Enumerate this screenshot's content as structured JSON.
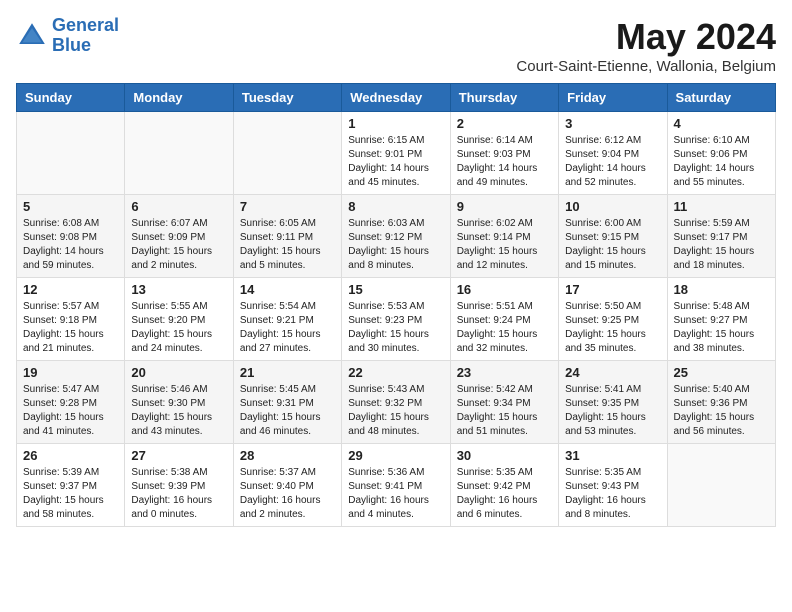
{
  "header": {
    "logo_line1": "General",
    "logo_line2": "Blue",
    "month": "May 2024",
    "location": "Court-Saint-Etienne, Wallonia, Belgium"
  },
  "weekdays": [
    "Sunday",
    "Monday",
    "Tuesday",
    "Wednesday",
    "Thursday",
    "Friday",
    "Saturday"
  ],
  "weeks": [
    [
      {
        "day": "",
        "info": ""
      },
      {
        "day": "",
        "info": ""
      },
      {
        "day": "",
        "info": ""
      },
      {
        "day": "1",
        "info": "Sunrise: 6:15 AM\nSunset: 9:01 PM\nDaylight: 14 hours\nand 45 minutes."
      },
      {
        "day": "2",
        "info": "Sunrise: 6:14 AM\nSunset: 9:03 PM\nDaylight: 14 hours\nand 49 minutes."
      },
      {
        "day": "3",
        "info": "Sunrise: 6:12 AM\nSunset: 9:04 PM\nDaylight: 14 hours\nand 52 minutes."
      },
      {
        "day": "4",
        "info": "Sunrise: 6:10 AM\nSunset: 9:06 PM\nDaylight: 14 hours\nand 55 minutes."
      }
    ],
    [
      {
        "day": "5",
        "info": "Sunrise: 6:08 AM\nSunset: 9:08 PM\nDaylight: 14 hours\nand 59 minutes."
      },
      {
        "day": "6",
        "info": "Sunrise: 6:07 AM\nSunset: 9:09 PM\nDaylight: 15 hours\nand 2 minutes."
      },
      {
        "day": "7",
        "info": "Sunrise: 6:05 AM\nSunset: 9:11 PM\nDaylight: 15 hours\nand 5 minutes."
      },
      {
        "day": "8",
        "info": "Sunrise: 6:03 AM\nSunset: 9:12 PM\nDaylight: 15 hours\nand 8 minutes."
      },
      {
        "day": "9",
        "info": "Sunrise: 6:02 AM\nSunset: 9:14 PM\nDaylight: 15 hours\nand 12 minutes."
      },
      {
        "day": "10",
        "info": "Sunrise: 6:00 AM\nSunset: 9:15 PM\nDaylight: 15 hours\nand 15 minutes."
      },
      {
        "day": "11",
        "info": "Sunrise: 5:59 AM\nSunset: 9:17 PM\nDaylight: 15 hours\nand 18 minutes."
      }
    ],
    [
      {
        "day": "12",
        "info": "Sunrise: 5:57 AM\nSunset: 9:18 PM\nDaylight: 15 hours\nand 21 minutes."
      },
      {
        "day": "13",
        "info": "Sunrise: 5:55 AM\nSunset: 9:20 PM\nDaylight: 15 hours\nand 24 minutes."
      },
      {
        "day": "14",
        "info": "Sunrise: 5:54 AM\nSunset: 9:21 PM\nDaylight: 15 hours\nand 27 minutes."
      },
      {
        "day": "15",
        "info": "Sunrise: 5:53 AM\nSunset: 9:23 PM\nDaylight: 15 hours\nand 30 minutes."
      },
      {
        "day": "16",
        "info": "Sunrise: 5:51 AM\nSunset: 9:24 PM\nDaylight: 15 hours\nand 32 minutes."
      },
      {
        "day": "17",
        "info": "Sunrise: 5:50 AM\nSunset: 9:25 PM\nDaylight: 15 hours\nand 35 minutes."
      },
      {
        "day": "18",
        "info": "Sunrise: 5:48 AM\nSunset: 9:27 PM\nDaylight: 15 hours\nand 38 minutes."
      }
    ],
    [
      {
        "day": "19",
        "info": "Sunrise: 5:47 AM\nSunset: 9:28 PM\nDaylight: 15 hours\nand 41 minutes."
      },
      {
        "day": "20",
        "info": "Sunrise: 5:46 AM\nSunset: 9:30 PM\nDaylight: 15 hours\nand 43 minutes."
      },
      {
        "day": "21",
        "info": "Sunrise: 5:45 AM\nSunset: 9:31 PM\nDaylight: 15 hours\nand 46 minutes."
      },
      {
        "day": "22",
        "info": "Sunrise: 5:43 AM\nSunset: 9:32 PM\nDaylight: 15 hours\nand 48 minutes."
      },
      {
        "day": "23",
        "info": "Sunrise: 5:42 AM\nSunset: 9:34 PM\nDaylight: 15 hours\nand 51 minutes."
      },
      {
        "day": "24",
        "info": "Sunrise: 5:41 AM\nSunset: 9:35 PM\nDaylight: 15 hours\nand 53 minutes."
      },
      {
        "day": "25",
        "info": "Sunrise: 5:40 AM\nSunset: 9:36 PM\nDaylight: 15 hours\nand 56 minutes."
      }
    ],
    [
      {
        "day": "26",
        "info": "Sunrise: 5:39 AM\nSunset: 9:37 PM\nDaylight: 15 hours\nand 58 minutes."
      },
      {
        "day": "27",
        "info": "Sunrise: 5:38 AM\nSunset: 9:39 PM\nDaylight: 16 hours\nand 0 minutes."
      },
      {
        "day": "28",
        "info": "Sunrise: 5:37 AM\nSunset: 9:40 PM\nDaylight: 16 hours\nand 2 minutes."
      },
      {
        "day": "29",
        "info": "Sunrise: 5:36 AM\nSunset: 9:41 PM\nDaylight: 16 hours\nand 4 minutes."
      },
      {
        "day": "30",
        "info": "Sunrise: 5:35 AM\nSunset: 9:42 PM\nDaylight: 16 hours\nand 6 minutes."
      },
      {
        "day": "31",
        "info": "Sunrise: 5:35 AM\nSunset: 9:43 PM\nDaylight: 16 hours\nand 8 minutes."
      },
      {
        "day": "",
        "info": ""
      }
    ]
  ]
}
